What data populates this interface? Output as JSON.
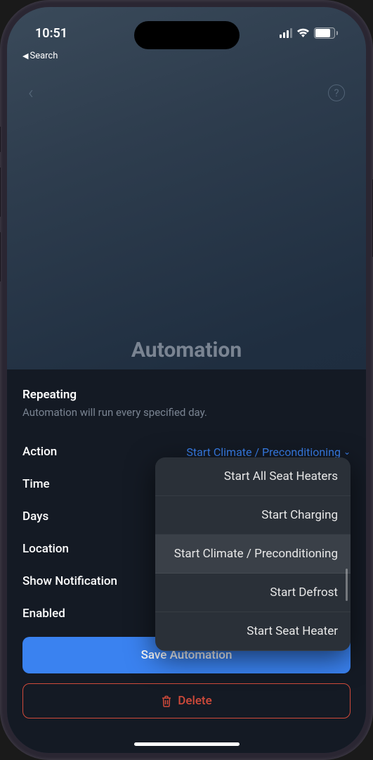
{
  "status": {
    "time": "10:51",
    "battery_pct": "75"
  },
  "breadcrumb": {
    "back_label": "Search"
  },
  "page": {
    "title": "Automation"
  },
  "section": {
    "title": "Repeating",
    "desc": "Automation will run every specified day."
  },
  "rows": {
    "action": {
      "label": "Action",
      "value": "Start Climate / Preconditioning"
    },
    "time": {
      "label": "Time"
    },
    "days": {
      "label": "Days"
    },
    "location": {
      "label": "Location"
    },
    "show_notification": {
      "label": "Show Notification"
    },
    "enabled": {
      "label": "Enabled"
    }
  },
  "dropdown": {
    "options": [
      "Start All Seat Heaters",
      "Start Charging",
      "Start Climate / Preconditioning",
      "Start Defrost",
      "Start Seat Heater"
    ],
    "selected_index": 2
  },
  "buttons": {
    "save": "Save Automation",
    "delete": "Delete"
  }
}
